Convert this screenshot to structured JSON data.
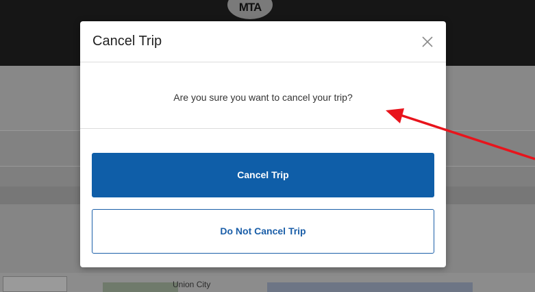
{
  "header": {
    "logo_text": "MTA"
  },
  "background": {
    "map_label": "Union City"
  },
  "modal": {
    "title": "Cancel Trip",
    "close_icon": "close-icon",
    "message": "Are you sure you want to cancel your trip?",
    "confirm_button_label": "Cancel Trip",
    "dismiss_button_label": "Do Not Cancel Trip"
  },
  "colors": {
    "primary": "#0f5ea8",
    "annotation_arrow": "#e8141c",
    "overlay": "#7f7f7f"
  }
}
